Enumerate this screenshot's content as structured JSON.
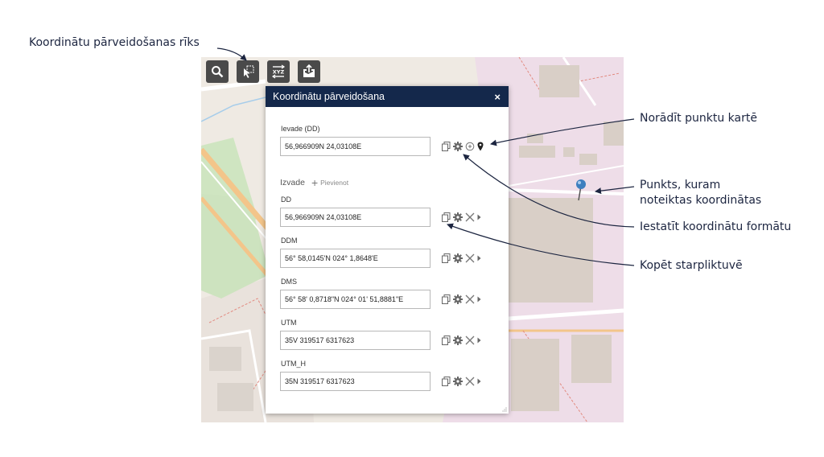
{
  "annotations": {
    "tool": "Koordinātu pārveidošanas rīks",
    "point_on_map": "Norādīt punktu kartē",
    "point_line1": "Punkts, kuram",
    "point_line2": "noteiktas koordinātas",
    "set_format": "Iestatīt koordinātu formātu",
    "copy": "Kopēt starpliktuvē"
  },
  "toolbar": {
    "buttons": [
      {
        "icon": "search-icon"
      },
      {
        "icon": "select-cursor-icon"
      },
      {
        "icon": "xyz-convert-icon"
      },
      {
        "icon": "map-export-icon"
      }
    ]
  },
  "panel": {
    "title": "Koordinātu pārveidošana",
    "close_label": "×",
    "input": {
      "label": "Ievade (DD)",
      "value": "56,966909N 24,03108E"
    },
    "output": {
      "label": "Izvade",
      "add_label": "Pievienot",
      "items": [
        {
          "label": "DD",
          "value": "56,966909N 24,03108E"
        },
        {
          "label": "DDM",
          "value": "56° 58,0145'N 024° 1,8648'E"
        },
        {
          "label": "DMS",
          "value": "56° 58' 0,8718\"N 024° 01' 51,8881\"E"
        },
        {
          "label": "UTM",
          "value": "35V 319517 6317623"
        },
        {
          "label": "UTM_H",
          "value": "35N 319517 6317623"
        }
      ]
    }
  },
  "colors": {
    "panel_header": "#14284b",
    "toolbar_button": "#4a4a4a",
    "annotation_text": "#1c2540",
    "map_residential": "#e8d9e4",
    "map_road_orange": "#f3c58a",
    "map_park": "#cde3bf",
    "map_water_line": "#a7cdea",
    "pin": "#3d7fbf"
  }
}
